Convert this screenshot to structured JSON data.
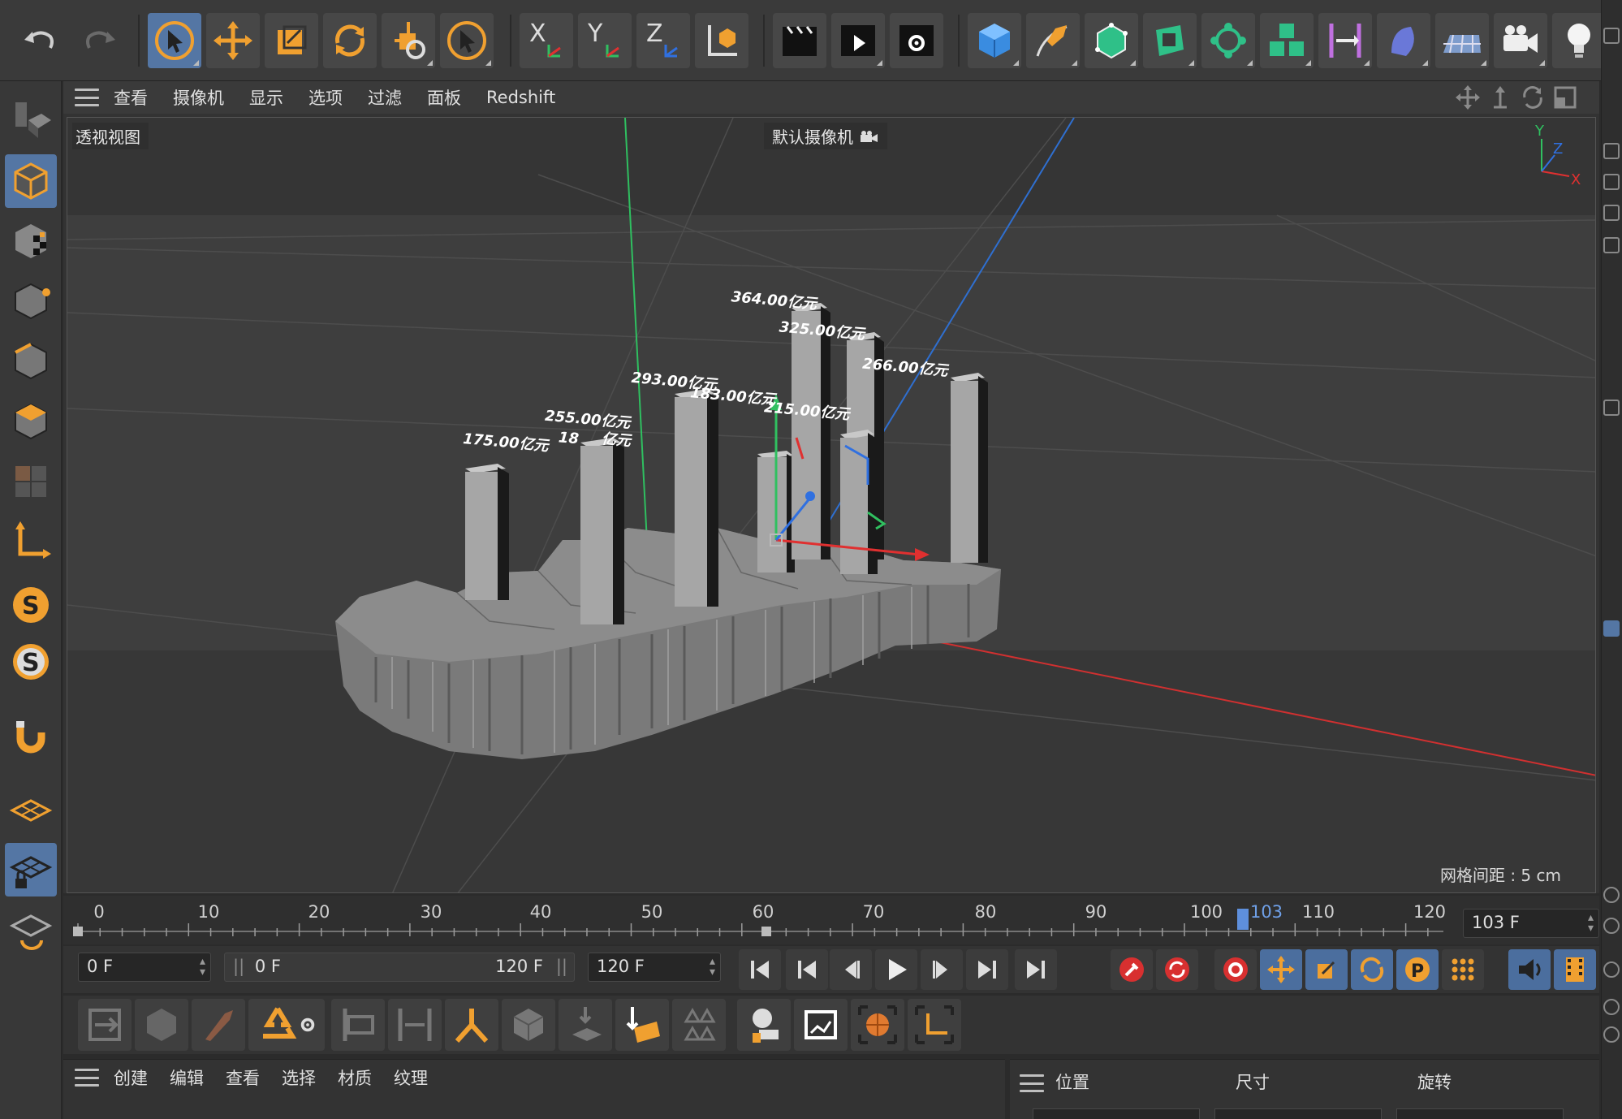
{
  "toolbar": {
    "undo": "undo-icon",
    "redo": "redo-icon",
    "axis_x": "X",
    "axis_y": "Y",
    "axis_z": "Z"
  },
  "viewport_menu": {
    "items": [
      "查看",
      "摄像机",
      "显示",
      "选项",
      "过滤",
      "面板",
      "Redshift"
    ]
  },
  "viewport": {
    "view_name": "透视视图",
    "camera_name": "默认摄像机",
    "grid_spacing": "网格间距 : 5 cm",
    "gizmo_axes": {
      "x": "X",
      "y": "Y",
      "z": "Z"
    }
  },
  "bar_labels": [
    "175.00亿元",
    "255.00亿元",
    "18",
    "亿元",
    "293.00亿元",
    "183.00亿元",
    "364.00亿元",
    "325.00亿元",
    "215.00亿元",
    "266.00亿元"
  ],
  "timeline": {
    "ticks": [
      "0",
      "10",
      "20",
      "30",
      "40",
      "50",
      "60",
      "70",
      "80",
      "90",
      "100",
      "110",
      "120"
    ],
    "current_marker": "103",
    "current_frame": "103 F"
  },
  "transport": {
    "start_frame": "0 F",
    "range_start": "0 F",
    "range_end": "120 F",
    "end_frame": "120 F"
  },
  "material_menu": {
    "items": [
      "创建",
      "编辑",
      "查看",
      "选择",
      "材质",
      "纹理"
    ]
  },
  "coord_manager": {
    "position": "位置",
    "size": "尺寸",
    "rotation": "旋转"
  },
  "colors": {
    "accent": "#5476a4",
    "orange": "#f0a030",
    "axis_x": "#e03030",
    "axis_y": "#30c060",
    "axis_z": "#3070e0",
    "current_frame": "#6fa0e8"
  }
}
